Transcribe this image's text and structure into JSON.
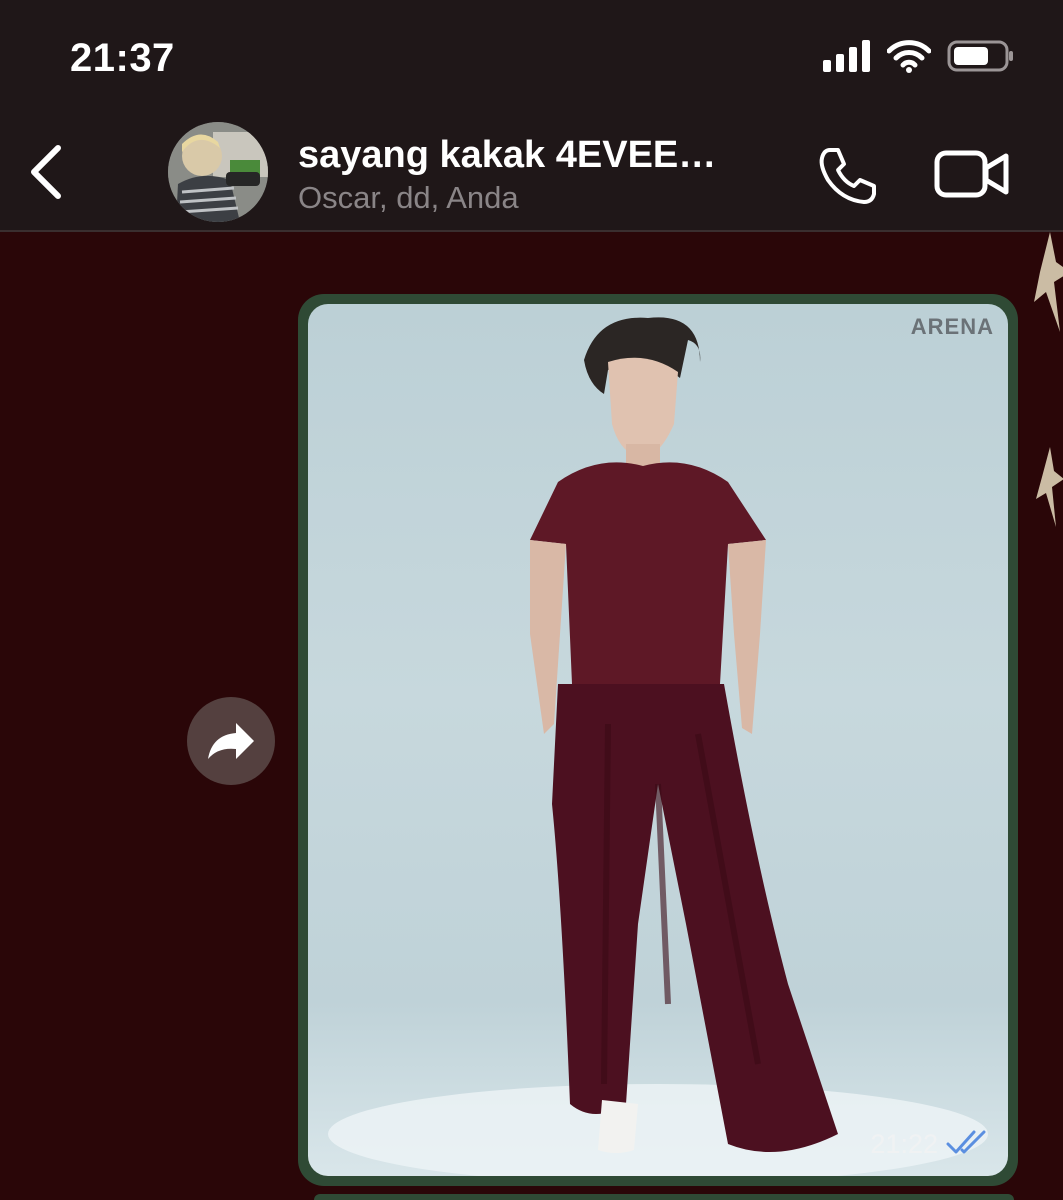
{
  "status_bar": {
    "time": "21:37"
  },
  "header": {
    "title": "sayang kakak 4EVEE…",
    "subtitle": "Oscar, dd, Anda"
  },
  "message": {
    "image_logo_text": "ARENA",
    "time": "21:22",
    "read_status": "read"
  },
  "colors": {
    "chat_background": "#2a0608",
    "header_background": "#1f1718",
    "bubble_border": "#2f4a35",
    "read_tick": "#5b8fe0"
  }
}
